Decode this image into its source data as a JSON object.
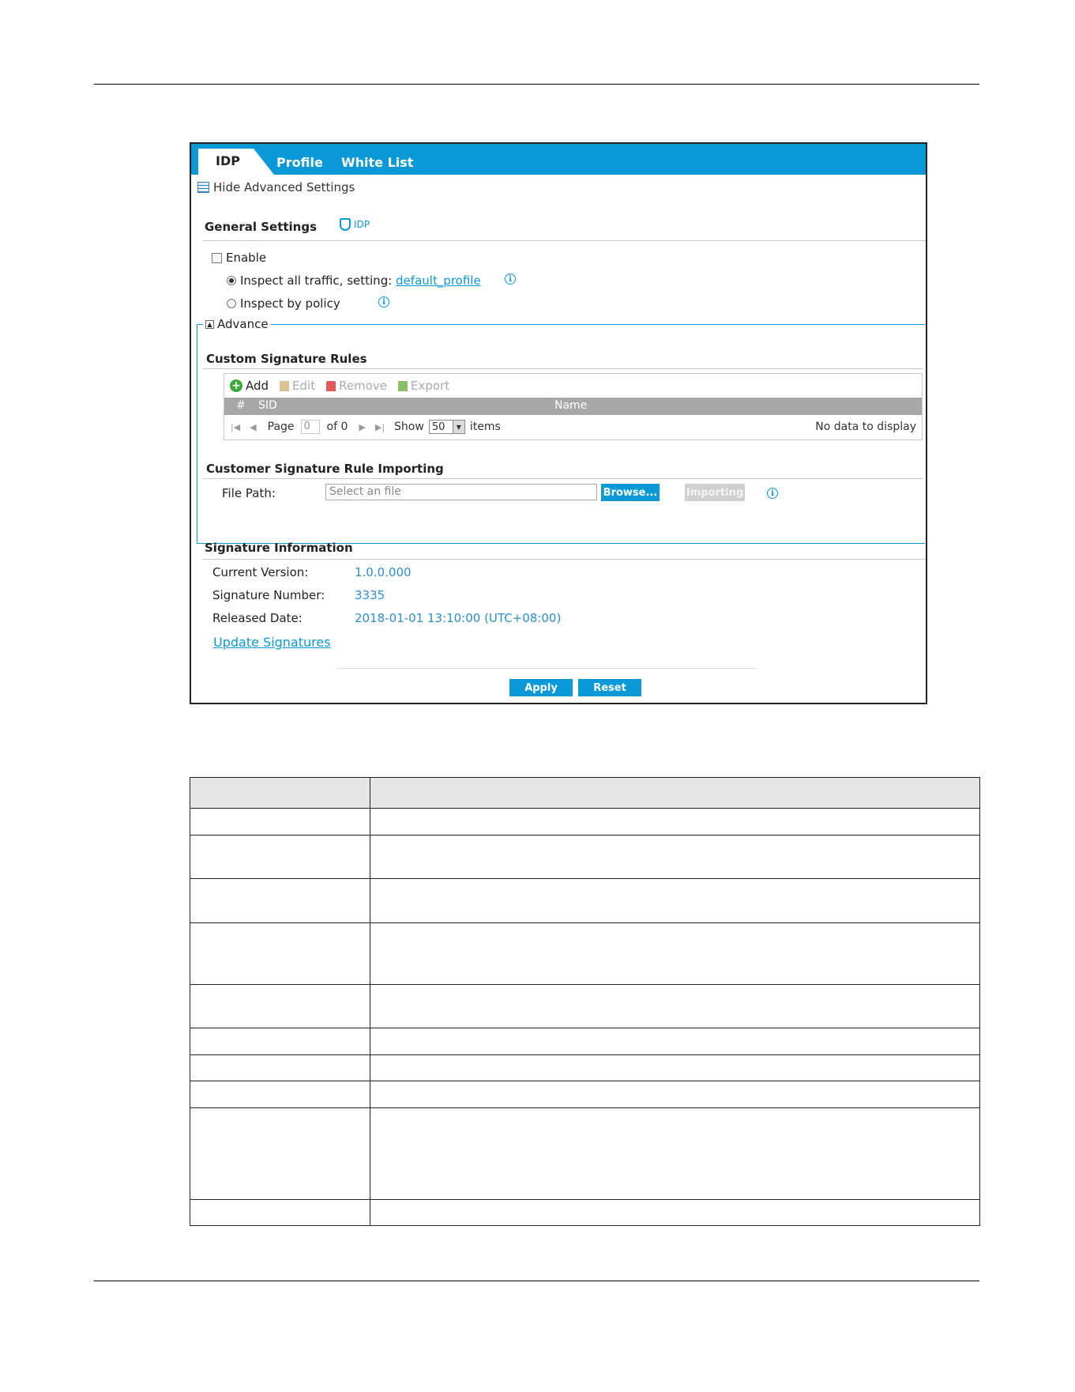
{
  "tabs": [
    "IDP",
    "Profile",
    "White List"
  ],
  "hide_advanced": "Hide Advanced Settings",
  "general": {
    "title": "General Settings",
    "badge": "IDP",
    "enable": "Enable",
    "inspect_all_prefix": "Inspect all traffic, setting: ",
    "inspect_all_link": "default_profile",
    "inspect_policy": "Inspect by policy",
    "info_glyph": "i"
  },
  "advance": {
    "label": "Advance",
    "collapse_glyph": "▲"
  },
  "custom_rules": {
    "title": "Custom Signature Rules",
    "toolbar": {
      "add": "Add",
      "edit": "Edit",
      "remove": "Remove",
      "export": "Export"
    },
    "columns": {
      "num": "#",
      "sid": "SID",
      "name": "Name"
    },
    "pager": {
      "page_label": "Page",
      "page_value": "0",
      "of": "of 0",
      "show": "Show",
      "per_page": "50",
      "items": "items",
      "empty": "No data to display"
    }
  },
  "importing": {
    "title": "Customer Signature Rule Importing",
    "file_path_label": "File Path:",
    "file_placeholder": "Select an file",
    "browse": "Browse...",
    "importing": "Importing"
  },
  "signature": {
    "title": "Signature Information",
    "current_version_label": "Current Version:",
    "current_version": "1.0.0.000",
    "number_label": "Signature Number:",
    "number": "3335",
    "released_label": "Released Date:",
    "released": "2018-01-01 13:10:00 (UTC+08:00)",
    "update_link": "Update Signatures"
  },
  "buttons": {
    "apply": "Apply",
    "reset": "Reset"
  },
  "colors": {
    "accent": "#0a99d6",
    "value_text": "#2d8fc9"
  }
}
